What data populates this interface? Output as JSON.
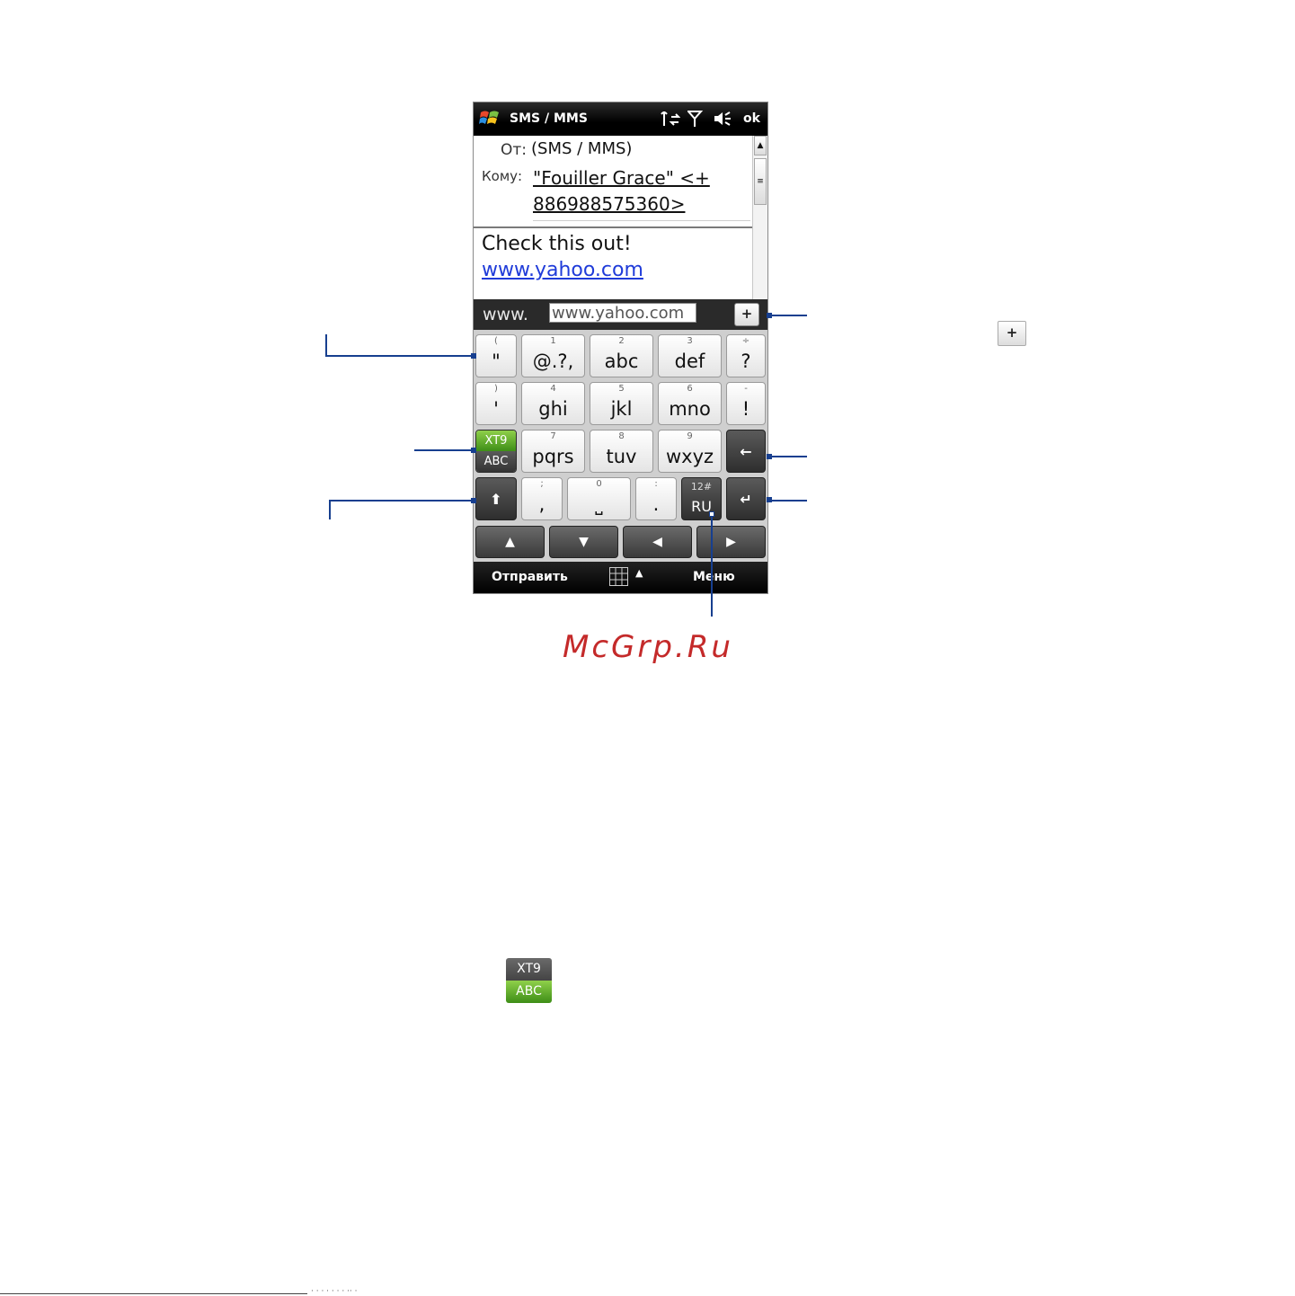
{
  "titlebar": {
    "app_title": "SMS / MMS",
    "ok_label": "ok",
    "icons": [
      "start-icon",
      "data-connection-icon",
      "signal-icon",
      "volume-icon"
    ]
  },
  "message": {
    "from_label": "От:",
    "from_value": "(SMS / MMS)",
    "to_label": "Кому:",
    "to_line1": "\"Fouiller Grace\" <+",
    "to_line2": "886988575360>",
    "body_text": "Check this out!",
    "body_link": "www.yahoo.com"
  },
  "urlbar": {
    "prefix": "www.",
    "value": "www.yahoo.com",
    "add_label": "+"
  },
  "keyboard": {
    "row1": [
      {
        "sub": "(",
        "main": "\""
      },
      {
        "sub": "1",
        "main": "@.?,"
      },
      {
        "sub": "2",
        "main": "abc"
      },
      {
        "sub": "3",
        "main": "def"
      },
      {
        "sub": "÷",
        "main": "?"
      }
    ],
    "row2": [
      {
        "sub": ")",
        "main": "'"
      },
      {
        "sub": "4",
        "main": "ghi"
      },
      {
        "sub": "5",
        "main": "jkl"
      },
      {
        "sub": "6",
        "main": "mno"
      },
      {
        "sub": "-",
        "main": "!"
      }
    ],
    "row3": [
      {
        "sub": "XT9",
        "main": "ABC"
      },
      {
        "sub": "7",
        "main": "pqrs"
      },
      {
        "sub": "8",
        "main": "tuv"
      },
      {
        "sub": "9",
        "main": "wxyz"
      },
      {
        "sub": "",
        "main": "←"
      }
    ],
    "row4": [
      {
        "sub": "",
        "main": "⬆"
      },
      {
        "sub": ";",
        "main": ","
      },
      {
        "sub": "0",
        "main": "⎵"
      },
      {
        "sub": ":",
        "main": "."
      },
      {
        "sub": "12#",
        "main": "RU"
      },
      {
        "sub": "",
        "main": "↵"
      }
    ],
    "nav": [
      "▲",
      "▼",
      "◀",
      "▶"
    ]
  },
  "menubar": {
    "left_softkey": "Отправить",
    "right_softkey": "Меню"
  },
  "watermark": "McGrp.Ru",
  "legend_icons": {
    "plus_label": "+",
    "xt9_top": "XT9",
    "xt9_bottom": "ABC"
  },
  "footer": {
    "text": "· · ·  ·  ·    ·     ·   ·· ·"
  },
  "colors": {
    "callout_line": "#173f8f",
    "link": "#1f3bd9",
    "xt9_green": "#3e8e17",
    "watermark": "#c42a2a"
  }
}
